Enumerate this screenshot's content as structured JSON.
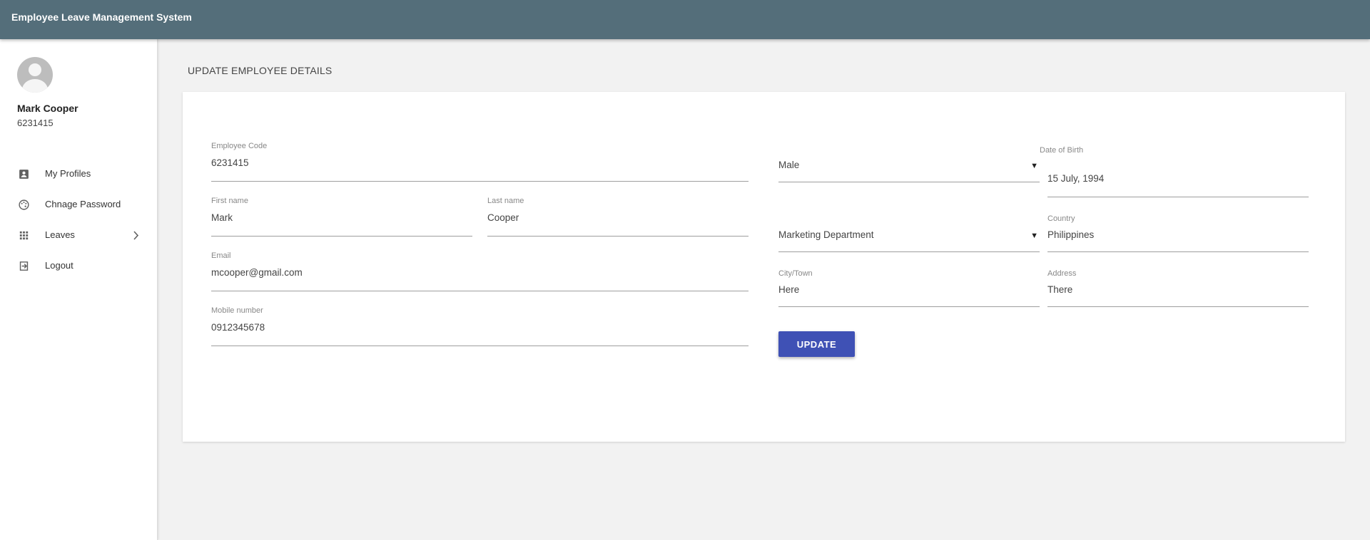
{
  "app": {
    "title": "Employee Leave Management System"
  },
  "user": {
    "name": "Mark Cooper",
    "code": "6231415"
  },
  "nav": [
    {
      "label": "My Profiles",
      "icon": "profile-card-icon"
    },
    {
      "label": "Chnage Password",
      "icon": "palette-icon"
    },
    {
      "label": "Leaves",
      "icon": "apps-grid-icon",
      "has_submenu": true
    },
    {
      "label": "Logout",
      "icon": "logout-icon"
    }
  ],
  "page": {
    "heading": "UPDATE EMPLOYEE DETAILS"
  },
  "form": {
    "employee_code": {
      "label": "Employee Code",
      "value": "6231415"
    },
    "first_name": {
      "label": "First name",
      "value": "Mark"
    },
    "last_name": {
      "label": "Last name",
      "value": "Cooper"
    },
    "email": {
      "label": "Email",
      "value": "mcooper@gmail.com"
    },
    "mobile": {
      "label": "Mobile number",
      "value": "0912345678"
    },
    "gender": {
      "value": "Male"
    },
    "date_of_birth": {
      "label": "Date of Birth",
      "value": "15 July, 1994"
    },
    "department": {
      "value": "Marketing Department"
    },
    "country": {
      "label": "Country",
      "value": "Philippines"
    },
    "city": {
      "label": "City/Town",
      "value": "Here"
    },
    "address": {
      "label": "Address",
      "value": "There"
    },
    "update_label": "UPDATE"
  },
  "colors": {
    "topbar": "#546e7a",
    "primary_button": "#3f51b5",
    "background": "#f2f2f2"
  }
}
